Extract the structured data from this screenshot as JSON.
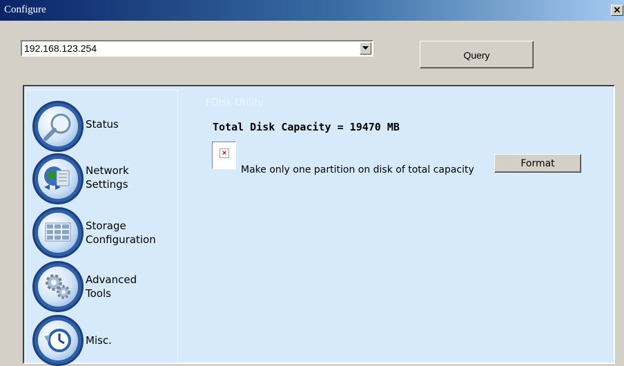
{
  "window": {
    "title": "Configure",
    "close_glyph": "✕"
  },
  "ip_combo": {
    "value": "192.168.123.254"
  },
  "query_button": {
    "label": "Query"
  },
  "sidebar": {
    "items": [
      {
        "label_lines": [
          "Status"
        ],
        "icon": "magnifier-icon"
      },
      {
        "label_lines": [
          "Network",
          "Settings"
        ],
        "icon": "network-globe-icon"
      },
      {
        "label_lines": [
          "Storage",
          "Configuration"
        ],
        "icon": "storage-grid-icon"
      },
      {
        "label_lines": [
          "Advanced",
          "Tools"
        ],
        "icon": "gears-icon"
      },
      {
        "label_lines": [
          "Misc."
        ],
        "icon": "clock-icon"
      }
    ]
  },
  "main": {
    "section_title": "FDisk Utility",
    "capacity_text": "Total Disk Capacity = 19470 MB",
    "checkbox_label": "Make only one partition on disk of total capacity",
    "format_button": "Format"
  },
  "colors": {
    "panel_bg": "#d7eafb",
    "title_start": "#0a246a",
    "icon_ring": "#2e5fa8"
  }
}
